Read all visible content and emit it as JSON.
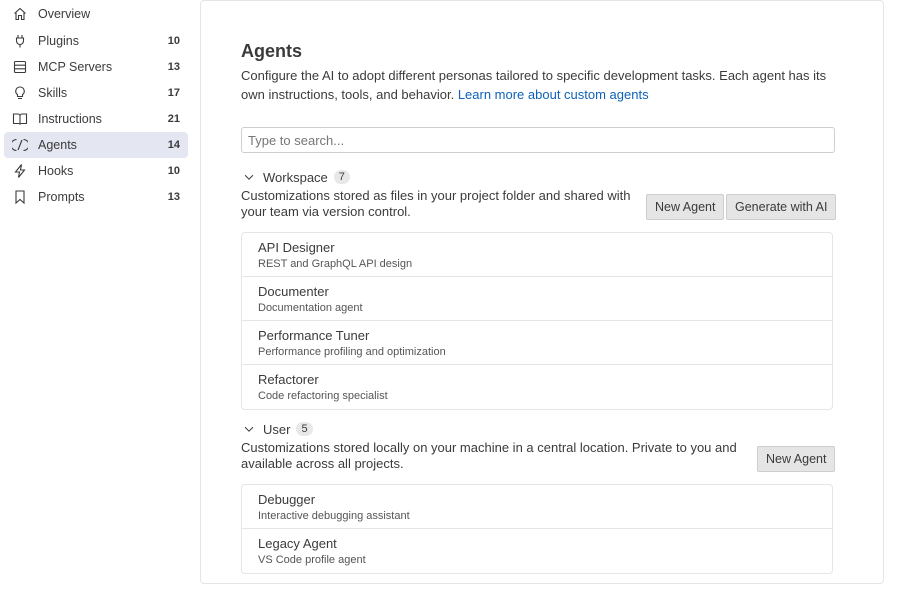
{
  "sidebar": {
    "items": [
      {
        "label": "Overview",
        "count": "",
        "icon": "home-icon"
      },
      {
        "label": "Plugins",
        "count": "10",
        "icon": "plug-icon"
      },
      {
        "label": "MCP Servers",
        "count": "13",
        "icon": "server-icon"
      },
      {
        "label": "Skills",
        "count": "17",
        "icon": "lightbulb-icon"
      },
      {
        "label": "Instructions",
        "count": "21",
        "icon": "book-icon"
      },
      {
        "label": "Agents",
        "count": "14",
        "icon": "agent-icon"
      },
      {
        "label": "Hooks",
        "count": "10",
        "icon": "lightning-icon"
      },
      {
        "label": "Prompts",
        "count": "13",
        "icon": "bookmark-icon"
      }
    ],
    "active": "Agents"
  },
  "main": {
    "title": "Agents",
    "description": "Configure the AI to adopt different personas tailored to specific development tasks. Each agent has its own instructions, tools, and behavior.",
    "learn_more": "Learn more about custom agents",
    "search_placeholder": "Type to search...",
    "workspace": {
      "title": "Workspace",
      "count": "7",
      "description": "Customizations stored as files in your project folder and shared with your team via version control.",
      "new_button": "New Agent",
      "generate_button": "Generate with AI",
      "items": [
        {
          "name": "API Designer",
          "desc": "REST and GraphQL API design"
        },
        {
          "name": "Documenter",
          "desc": "Documentation agent"
        },
        {
          "name": "Performance Tuner",
          "desc": "Performance profiling and optimization"
        },
        {
          "name": "Refactorer",
          "desc": "Code refactoring specialist"
        }
      ]
    },
    "user": {
      "title": "User",
      "count": "5",
      "description": "Customizations stored locally on your machine in a central location. Private to you and available across all projects.",
      "new_button": "New Agent",
      "items": [
        {
          "name": "Debugger",
          "desc": "Interactive debugging assistant"
        },
        {
          "name": "Legacy Agent",
          "desc": "VS Code profile agent"
        }
      ]
    }
  },
  "colors": {
    "accent_link": "#0e62b8",
    "active_bg": "#e4e6f1",
    "button_bg": "#e5e5e5",
    "border": "#e5e5e5"
  }
}
